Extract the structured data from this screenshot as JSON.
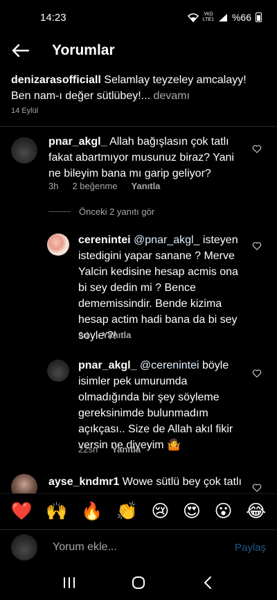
{
  "status_bar": {
    "time": "14:23",
    "network_top": "Vo))",
    "network_bottom": "LTE1",
    "battery": "%66"
  },
  "header": {
    "title": "Yorumlar"
  },
  "caption": {
    "username": "denizarasofficiall",
    "text": " Selamlay teyzeley amcalayy! Ben nam-ı değer sütlübey!...",
    "more": " devamı",
    "date": "14 Eylül"
  },
  "comments": [
    {
      "username": "pnar_akgl_",
      "text": " Allah bağışlasın çok tatlı fakat abartmıyor musunuz biraz? Yani ne bileyim bana mı garip geliyor?",
      "time": "3h",
      "likes": "2 beğenme",
      "reply": "Yanıtla"
    }
  ],
  "view_replies": "Önceki 2 yanıtı gör",
  "replies": [
    {
      "username": "cerenintei",
      "mention": " @pnar_akgl_",
      "text": " isteyen istedigini yapar sanane ? Merve Yalcin kedisine hesap acmis ona bi sey dedin mi ? Bence dememissindir. Bende kizima hesap actim hadi bana da bi sey soyle ?!",
      "time": "2d",
      "reply": "Yanıtla"
    },
    {
      "username": "pnar_akgl_",
      "mention": " @cerenintei",
      "text": " böyle isimler pek umurumda olmadığında bir şey söyleme gereksinimde bulunmadım açıkçası.. Size de Allah akıl fikir versin ne diyeyim 🤷",
      "time": "22sn",
      "reply": "Yanıtla"
    }
  ],
  "last_comment": {
    "username": "ayse_kndmr1",
    "text": " Wowe sütlü bey çok tatlı"
  },
  "emojis": [
    "❤️",
    "🙌",
    "🔥",
    "👏",
    "😢",
    "😍",
    "😮",
    "😂"
  ],
  "input": {
    "placeholder": "Yorum ekle...",
    "post_label": "Paylaş"
  },
  "colors": {
    "background": "#000000",
    "secondary_text": "#a8a8a8",
    "post_button_disabled": "#1e5a8a"
  }
}
